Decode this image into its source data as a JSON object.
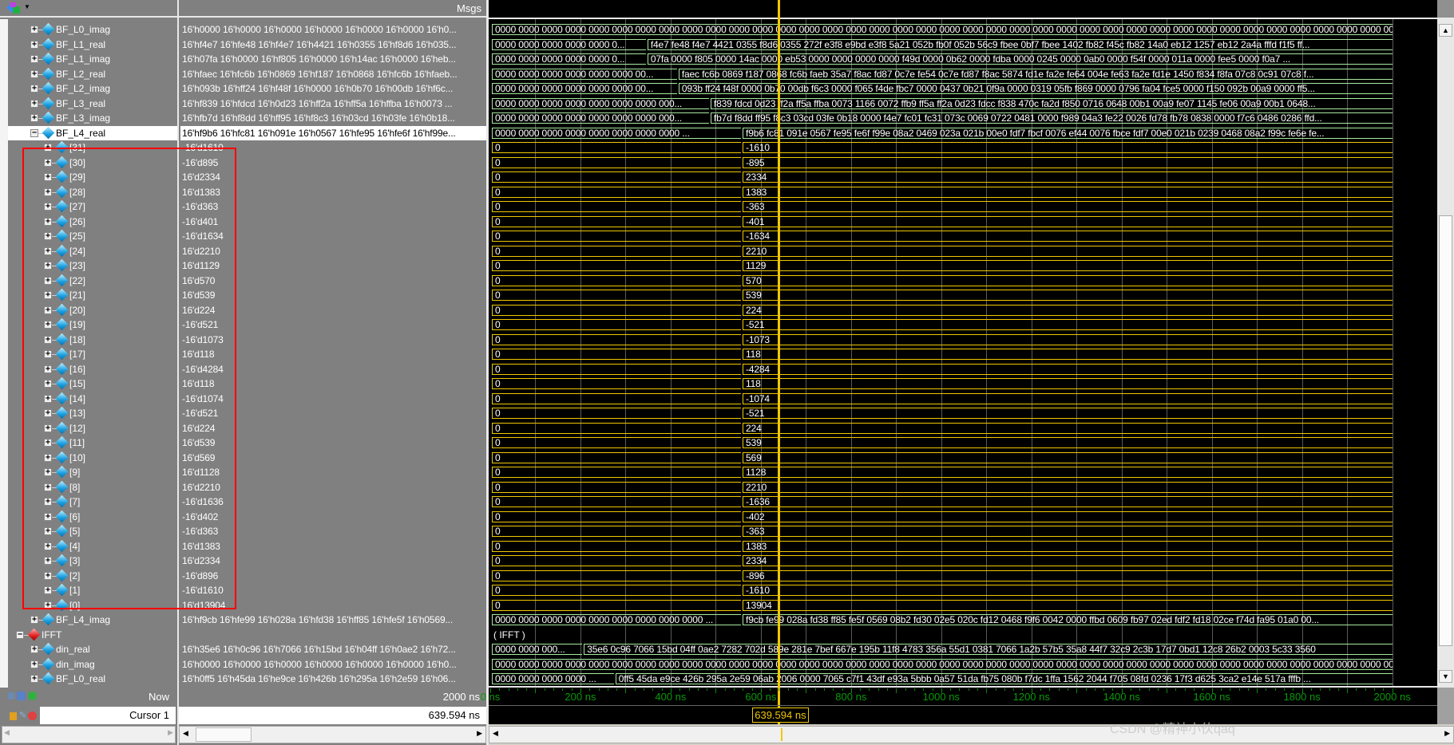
{
  "header": {
    "msgs_label": "Msgs"
  },
  "colors": {
    "bus_green": "#a8e8a0",
    "bus_yellow": "#f0c800",
    "cursor": "#f0c800",
    "highlight_box": "#ff0000",
    "time_axis": "#0a9a0a"
  },
  "rows": [
    {
      "name": "BF_L0_imag",
      "level": 1,
      "expand": "+",
      "msgs": "16'h0000 16'h0000 16'h0000 16'h0000 16'h0000 16'h0000 16'h0...",
      "color": "green",
      "wave": [
        {
          "t0": 0,
          "t1": 2000,
          "label": "0000 0000 0000 0000 0000 0000 0000 0000 0000 0000 0000 0000 0000 0000 0000 0000 0000 0000 0000 0000 0000 0000 0000 0000 0000 0000 0000 0000 0000 0000 0000 0000 0000 0000 0000 0000 0000 0000 0000"
        }
      ]
    },
    {
      "name": "BF_L1_real",
      "level": 1,
      "expand": "+",
      "msgs": "16'hf4e7 16'hfe48 16'hf4e7 16'h4421 16'h0355 16'hf8d6 16'h035...",
      "color": "green",
      "wave": [
        {
          "t0": 0,
          "t1": 345,
          "label": "0000 0000 0000 0000 0000 0..."
        },
        {
          "t0": 345,
          "t1": 2000,
          "label": "f4e7 fe48 f4e7 4421 0355 f8d6 0355 272f e3f8 e9bd e3f8 5a21 052b fb0f 052b 56c9 fbee 0bf7 fbee 1402 fb82 f45c fb82 14a0 eb12 1257 eb12 2a4a fffd f1f5 ff..."
        }
      ]
    },
    {
      "name": "BF_L1_imag",
      "level": 1,
      "expand": "+",
      "msgs": "16'h07fa 16'h0000 16'hf805 16'h0000 16'h14ac 16'h0000 16'heb...",
      "color": "green",
      "wave": [
        {
          "t0": 0,
          "t1": 345,
          "label": "0000 0000 0000 0000 0000 0..."
        },
        {
          "t0": 345,
          "t1": 2000,
          "label": "07fa 0000 f805 0000 14ac 0000 eb53 0000 0000 0000 0000 f49d 0000 0b62 0000 fdba 0000 0245 0000 0ab0 0000 f54f 0000 011a 0000 fee5 0000 f0a7 ..."
        }
      ]
    },
    {
      "name": "BF_L2_real",
      "level": 1,
      "expand": "+",
      "msgs": "16'hfaec 16'hfc6b 16'h0869 16'hf187 16'h0868 16'hfc6b 16'hfaeb...",
      "color": "green",
      "wave": [
        {
          "t0": 0,
          "t1": 414,
          "label": "0000 0000 0000 0000 0000 0000 00..."
        },
        {
          "t0": 414,
          "t1": 2000,
          "label": "faec fc6b 0869 f187 0868 fc6b faeb 35a7 f8ac fd87 0c7e fe54 0c7e fd87 f8ac 5874 fd1e fa2e fe64 004e fe63 fa2e fd1e 1450 f834 f8fa 07c8 0c91 07c8 f..."
        }
      ]
    },
    {
      "name": "BF_L2_imag",
      "level": 1,
      "expand": "+",
      "msgs": "16'h093b 16'hff24 16'hf48f 16'h0000 16'h0b70 16'h00db 16'hf6c...",
      "color": "green",
      "wave": [
        {
          "t0": 0,
          "t1": 414,
          "label": "0000 0000 0000 0000 0000 0000 00..."
        },
        {
          "t0": 414,
          "t1": 2000,
          "label": "093b ff24 f48f 0000 0b70 00db f6c3 0000 f065 f4de fbc7 0000 0437 0b21 0f9a 0000 0319 05fb f869 0000 0796 fa04 fce5 0000 f150 092b 00a9 0000 ff5..."
        }
      ]
    },
    {
      "name": "BF_L3_real",
      "level": 1,
      "expand": "+",
      "msgs": "16'hf839 16'hfdcd 16'h0d23 16'hff2a 16'hff5a 16'hffba 16'h0073 ...",
      "color": "green",
      "wave": [
        {
          "t0": 0,
          "t1": 485,
          "label": "0000 0000 0000 0000 0000 0000 0000 000..."
        },
        {
          "t0": 485,
          "t1": 2000,
          "label": "f839 fdcd 0d23 ff2a ff5a ffba 0073 1166 0072 ffb9 ff5a ff2a 0d23 fdcc f838 470c fa2d f850 0716 0648 00b1 00a9 fe07 1145 fe06 00a9 00b1 0648..."
        }
      ]
    },
    {
      "name": "BF_L3_imag",
      "level": 1,
      "expand": "+",
      "msgs": "16'hfb7d 16'hf8dd 16'hff95 16'hf8c3 16'h03cd 16'h03fe 16'h0b18...",
      "color": "green",
      "wave": [
        {
          "t0": 0,
          "t1": 485,
          "label": "0000 0000 0000 0000 0000 0000 0000 000..."
        },
        {
          "t0": 485,
          "t1": 2000,
          "label": "fb7d f8dd ff95 f8c3 03cd 03fe 0b18 0000 f4e7 fc01 fc31 073c 0069 0722 0481 0000 f989 04a3 fe22 0026 fd78 fb78 0838 0000 f7c6 0486 0286 ffd..."
        }
      ]
    },
    {
      "name": "BF_L4_real",
      "level": 1,
      "expand": "-",
      "selected": true,
      "msgs": "16'hf9b6 16'hfc81 16'h091e 16'h0567 16'hfe95 16'hfe6f 16'hf99e...",
      "color": "green",
      "wave": [
        {
          "t0": 0,
          "t1": 556,
          "label": "0000 0000 0000 0000 0000 0000 0000 0000 ..."
        },
        {
          "t0": 556,
          "t1": 2000,
          "label": "f9b6 fc81 091e 0567 fe95 fe6f f99e 08a2 0469 023a 021b 00e0 fdf7 fbcf 0076 ef44 0076 fbce fdf7 00e0 021b 0239 0468 08a2 f99c fe6e fe..."
        }
      ]
    },
    {
      "name": "[31]",
      "level": 2,
      "expand": "+",
      "msgs": "-16'd1610",
      "color": "yellow",
      "wave": [
        {
          "t0": 0,
          "t1": 556,
          "label": "0"
        },
        {
          "t0": 556,
          "t1": 2000,
          "label": "-1610"
        }
      ]
    },
    {
      "name": "[30]",
      "level": 2,
      "expand": "+",
      "msgs": "-16'd895",
      "color": "yellow",
      "wave": [
        {
          "t0": 0,
          "t1": 556,
          "label": "0"
        },
        {
          "t0": 556,
          "t1": 2000,
          "label": "-895"
        }
      ]
    },
    {
      "name": "[29]",
      "level": 2,
      "expand": "+",
      "msgs": "16'd2334",
      "color": "yellow",
      "wave": [
        {
          "t0": 0,
          "t1": 556,
          "label": "0"
        },
        {
          "t0": 556,
          "t1": 2000,
          "label": "2334"
        }
      ]
    },
    {
      "name": "[28]",
      "level": 2,
      "expand": "+",
      "msgs": "16'd1383",
      "color": "yellow",
      "wave": [
        {
          "t0": 0,
          "t1": 556,
          "label": "0"
        },
        {
          "t0": 556,
          "t1": 2000,
          "label": "1383"
        }
      ]
    },
    {
      "name": "[27]",
      "level": 2,
      "expand": "+",
      "msgs": "-16'd363",
      "color": "yellow",
      "wave": [
        {
          "t0": 0,
          "t1": 556,
          "label": "0"
        },
        {
          "t0": 556,
          "t1": 2000,
          "label": "-363"
        }
      ]
    },
    {
      "name": "[26]",
      "level": 2,
      "expand": "+",
      "msgs": "-16'd401",
      "color": "yellow",
      "wave": [
        {
          "t0": 0,
          "t1": 556,
          "label": "0"
        },
        {
          "t0": 556,
          "t1": 2000,
          "label": "-401"
        }
      ]
    },
    {
      "name": "[25]",
      "level": 2,
      "expand": "+",
      "msgs": "-16'd1634",
      "color": "yellow",
      "wave": [
        {
          "t0": 0,
          "t1": 556,
          "label": "0"
        },
        {
          "t0": 556,
          "t1": 2000,
          "label": "-1634"
        }
      ]
    },
    {
      "name": "[24]",
      "level": 2,
      "expand": "+",
      "msgs": "16'd2210",
      "color": "yellow",
      "wave": [
        {
          "t0": 0,
          "t1": 556,
          "label": "0"
        },
        {
          "t0": 556,
          "t1": 2000,
          "label": "2210"
        }
      ]
    },
    {
      "name": "[23]",
      "level": 2,
      "expand": "+",
      "msgs": "16'd1129",
      "color": "yellow",
      "wave": [
        {
          "t0": 0,
          "t1": 556,
          "label": "0"
        },
        {
          "t0": 556,
          "t1": 2000,
          "label": "1129"
        }
      ]
    },
    {
      "name": "[22]",
      "level": 2,
      "expand": "+",
      "msgs": "16'd570",
      "color": "yellow",
      "wave": [
        {
          "t0": 0,
          "t1": 556,
          "label": "0"
        },
        {
          "t0": 556,
          "t1": 2000,
          "label": "570"
        }
      ]
    },
    {
      "name": "[21]",
      "level": 2,
      "expand": "+",
      "msgs": "16'd539",
      "color": "yellow",
      "wave": [
        {
          "t0": 0,
          "t1": 556,
          "label": "0"
        },
        {
          "t0": 556,
          "t1": 2000,
          "label": "539"
        }
      ]
    },
    {
      "name": "[20]",
      "level": 2,
      "expand": "+",
      "msgs": "16'd224",
      "color": "yellow",
      "wave": [
        {
          "t0": 0,
          "t1": 556,
          "label": "0"
        },
        {
          "t0": 556,
          "t1": 2000,
          "label": "224"
        }
      ]
    },
    {
      "name": "[19]",
      "level": 2,
      "expand": "+",
      "msgs": "-16'd521",
      "color": "yellow",
      "wave": [
        {
          "t0": 0,
          "t1": 556,
          "label": "0"
        },
        {
          "t0": 556,
          "t1": 2000,
          "label": "-521"
        }
      ]
    },
    {
      "name": "[18]",
      "level": 2,
      "expand": "+",
      "msgs": "-16'd1073",
      "color": "yellow",
      "wave": [
        {
          "t0": 0,
          "t1": 556,
          "label": "0"
        },
        {
          "t0": 556,
          "t1": 2000,
          "label": "-1073"
        }
      ]
    },
    {
      "name": "[17]",
      "level": 2,
      "expand": "+",
      "msgs": "16'd118",
      "color": "yellow",
      "wave": [
        {
          "t0": 0,
          "t1": 556,
          "label": "0"
        },
        {
          "t0": 556,
          "t1": 2000,
          "label": "118"
        }
      ]
    },
    {
      "name": "[16]",
      "level": 2,
      "expand": "+",
      "msgs": "-16'd4284",
      "color": "yellow",
      "wave": [
        {
          "t0": 0,
          "t1": 556,
          "label": "0"
        },
        {
          "t0": 556,
          "t1": 2000,
          "label": "-4284"
        }
      ]
    },
    {
      "name": "[15]",
      "level": 2,
      "expand": "+",
      "msgs": "16'd118",
      "color": "yellow",
      "wave": [
        {
          "t0": 0,
          "t1": 556,
          "label": "0"
        },
        {
          "t0": 556,
          "t1": 2000,
          "label": "118"
        }
      ]
    },
    {
      "name": "[14]",
      "level": 2,
      "expand": "+",
      "msgs": "-16'd1074",
      "color": "yellow",
      "wave": [
        {
          "t0": 0,
          "t1": 556,
          "label": "0"
        },
        {
          "t0": 556,
          "t1": 2000,
          "label": "-1074"
        }
      ]
    },
    {
      "name": "[13]",
      "level": 2,
      "expand": "+",
      "msgs": "-16'd521",
      "color": "yellow",
      "wave": [
        {
          "t0": 0,
          "t1": 556,
          "label": "0"
        },
        {
          "t0": 556,
          "t1": 2000,
          "label": "-521"
        }
      ]
    },
    {
      "name": "[12]",
      "level": 2,
      "expand": "+",
      "msgs": "16'd224",
      "color": "yellow",
      "wave": [
        {
          "t0": 0,
          "t1": 556,
          "label": "0"
        },
        {
          "t0": 556,
          "t1": 2000,
          "label": "224"
        }
      ]
    },
    {
      "name": "[11]",
      "level": 2,
      "expand": "+",
      "msgs": "16'd539",
      "color": "yellow",
      "wave": [
        {
          "t0": 0,
          "t1": 556,
          "label": "0"
        },
        {
          "t0": 556,
          "t1": 2000,
          "label": "539"
        }
      ]
    },
    {
      "name": "[10]",
      "level": 2,
      "expand": "+",
      "msgs": "16'd569",
      "color": "yellow",
      "wave": [
        {
          "t0": 0,
          "t1": 556,
          "label": "0"
        },
        {
          "t0": 556,
          "t1": 2000,
          "label": "569"
        }
      ]
    },
    {
      "name": "[9]",
      "level": 2,
      "expand": "+",
      "msgs": "16'd1128",
      "color": "yellow",
      "wave": [
        {
          "t0": 0,
          "t1": 556,
          "label": "0"
        },
        {
          "t0": 556,
          "t1": 2000,
          "label": "1128"
        }
      ]
    },
    {
      "name": "[8]",
      "level": 2,
      "expand": "+",
      "msgs": "16'd2210",
      "color": "yellow",
      "wave": [
        {
          "t0": 0,
          "t1": 556,
          "label": "0"
        },
        {
          "t0": 556,
          "t1": 2000,
          "label": "2210"
        }
      ]
    },
    {
      "name": "[7]",
      "level": 2,
      "expand": "+",
      "msgs": "-16'd1636",
      "color": "yellow",
      "wave": [
        {
          "t0": 0,
          "t1": 556,
          "label": "0"
        },
        {
          "t0": 556,
          "t1": 2000,
          "label": "-1636"
        }
      ]
    },
    {
      "name": "[6]",
      "level": 2,
      "expand": "+",
      "msgs": "-16'd402",
      "color": "yellow",
      "wave": [
        {
          "t0": 0,
          "t1": 556,
          "label": "0"
        },
        {
          "t0": 556,
          "t1": 2000,
          "label": "-402"
        }
      ]
    },
    {
      "name": "[5]",
      "level": 2,
      "expand": "+",
      "msgs": "-16'd363",
      "color": "yellow",
      "wave": [
        {
          "t0": 0,
          "t1": 556,
          "label": "0"
        },
        {
          "t0": 556,
          "t1": 2000,
          "label": "-363"
        }
      ]
    },
    {
      "name": "[4]",
      "level": 2,
      "expand": "+",
      "msgs": "16'd1383",
      "color": "yellow",
      "wave": [
        {
          "t0": 0,
          "t1": 556,
          "label": "0"
        },
        {
          "t0": 556,
          "t1": 2000,
          "label": "1383"
        }
      ]
    },
    {
      "name": "[3]",
      "level": 2,
      "expand": "+",
      "msgs": "16'd2334",
      "color": "yellow",
      "wave": [
        {
          "t0": 0,
          "t1": 556,
          "label": "0"
        },
        {
          "t0": 556,
          "t1": 2000,
          "label": "2334"
        }
      ]
    },
    {
      "name": "[2]",
      "level": 2,
      "expand": "+",
      "msgs": "-16'd896",
      "color": "yellow",
      "wave": [
        {
          "t0": 0,
          "t1": 556,
          "label": "0"
        },
        {
          "t0": 556,
          "t1": 2000,
          "label": "-896"
        }
      ]
    },
    {
      "name": "[1]",
      "level": 2,
      "expand": "+",
      "msgs": "-16'd1610",
      "color": "yellow",
      "wave": [
        {
          "t0": 0,
          "t1": 556,
          "label": "0"
        },
        {
          "t0": 556,
          "t1": 2000,
          "label": "-1610"
        }
      ]
    },
    {
      "name": "[0]",
      "level": 2,
      "expand": "+",
      "msgs": "16'd13904",
      "color": "yellow",
      "wave": [
        {
          "t0": 0,
          "t1": 556,
          "label": "0"
        },
        {
          "t0": 556,
          "t1": 2000,
          "label": "13904"
        }
      ]
    },
    {
      "name": "BF_L4_imag",
      "level": 1,
      "expand": "+",
      "msgs": "16'hf9cb 16'hfe99 16'h028a 16'hfd38 16'hff85 16'hfe5f 16'h0569...",
      "color": "green",
      "wave": [
        {
          "t0": 0,
          "t1": 556,
          "label": "0000 0000 0000 0000 0000 0000 0000 0000 0000 ..."
        },
        {
          "t0": 556,
          "t1": 2000,
          "label": "f9cb fe99 028a fd38 ff85 fe5f 0569 08b2 fd30 02e5 020c fd12 0468 f9f6 0042 0000 ffbd 0609 fb97 02ed fdf2 fd18 02ce f74d fa95 01a0 00..."
        }
      ]
    },
    {
      "name": "IFFT",
      "level": 0,
      "expand": "-",
      "group": true,
      "msgs": "",
      "color": "none",
      "wave_label": "( IFFT )",
      "wave": []
    },
    {
      "name": "din_real",
      "level": 1,
      "expand": "+",
      "msgs": "16'h35e6 16'h0c96 16'h7066 16'h15bd 16'h04ff 16'h0ae2 16'h72...",
      "color": "green",
      "wave": [
        {
          "t0": 0,
          "t1": 204,
          "label": "0000 0000 000..."
        },
        {
          "t0": 204,
          "t1": 2000,
          "label": "35e6 0c96 7066 15bd 04ff 0ae2 7282 702d 589e 281e 7bef 667e 195b 11f8 4783 356a 55d1 0381 7066 1a2b 57b5 35a8 44f7 32c9 2c3b 17d7 0bd1 12c8 26b2 0003 5c33 3560"
        }
      ]
    },
    {
      "name": "din_imag",
      "level": 1,
      "expand": "+",
      "msgs": "16'h0000 16'h0000 16'h0000 16'h0000 16'h0000 16'h0000 16'h0...",
      "color": "green",
      "wave": [
        {
          "t0": 0,
          "t1": 2000,
          "label": "0000 0000 0000 0000 0000 0000 0000 0000 0000 0000 0000 0000 0000 0000 0000 0000 0000 0000 0000 0000 0000 0000 0000 0000 0000 0000 0000 0000 0000 0000 0000 0000 0000 0000 0000 0000 0000 0000 0000"
        }
      ]
    },
    {
      "name": "BF_L0_real",
      "level": 1,
      "expand": "+",
      "msgs": "16'h0ff5 16'h45da 16'he9ce 16'h426b 16'h295a 16'h2e59 16'h06...",
      "color": "green",
      "wave": [
        {
          "t0": 0,
          "t1": 274,
          "label": "0000 0000 0000 0000 ..."
        },
        {
          "t0": 274,
          "t1": 2000,
          "label": "0ff5 45da e9ce 426b 295a 2e59 06ab 2006 0000 7065 c7f1 43df e93a 5bbb 0a57 51da fb75 080b f7dc 1ffa 1562 2044 f705 08fd 0236 17f3 d625 3ca2 e14e 517a fffb ..."
        }
      ]
    }
  ],
  "footer": {
    "now_label": "Now",
    "now_value": "2000 ns",
    "cursor_label": "Cursor 1",
    "cursor_value": "639.594 ns",
    "cursor_time_ns": 639.594,
    "cursor_tag": "639.594 ns"
  },
  "time_axis": {
    "range_ns": [
      0,
      2000
    ],
    "labels": [
      "0 ns",
      "200 ns",
      "400 ns",
      "600 ns",
      "800 ns",
      "1000 ns",
      "1200 ns",
      "1400 ns",
      "1600 ns",
      "1800 ns",
      "2000 ns"
    ],
    "label_times_ns": [
      0,
      200,
      400,
      600,
      800,
      1000,
      1200,
      1400,
      1600,
      1800,
      2000
    ]
  },
  "watermark": "CSDN @精神小伙qaq"
}
